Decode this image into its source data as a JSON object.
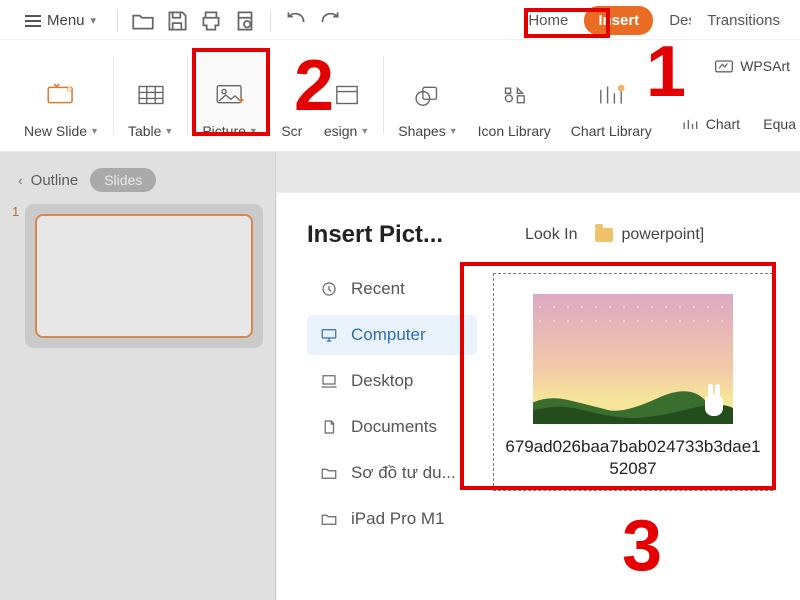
{
  "topbar": {
    "menu_label": "Menu"
  },
  "tabs": {
    "home": "Home",
    "insert": "Insert",
    "design": "Design",
    "transitions": "Transitions"
  },
  "ribbon": {
    "new_slide": "New Slide",
    "table": "Table",
    "picture": "Picture",
    "screenshot_partial": "Scr",
    "design_partial": "esign",
    "shapes": "Shapes",
    "icon_library": "Icon Library",
    "chart_library": "Chart Library",
    "wpsart": "WPSArt",
    "chart": "Chart",
    "equation_partial": "Equa"
  },
  "leftpanel": {
    "outline": "Outline",
    "slides": "Slides",
    "slide_number": "1"
  },
  "dialog": {
    "title": "Insert Pict...",
    "look_in": "Look In",
    "folder": "powerpoint]",
    "side": {
      "recent": "Recent",
      "computer": "Computer",
      "desktop": "Desktop",
      "documents": "Documents",
      "item5": "Sơ đồ tư du...",
      "item6": "iPad Pro M1"
    },
    "file_name": "679ad026baa7bab024733b3dae152087"
  },
  "annotations": {
    "n1": "1",
    "n2": "2",
    "n3": "3"
  }
}
